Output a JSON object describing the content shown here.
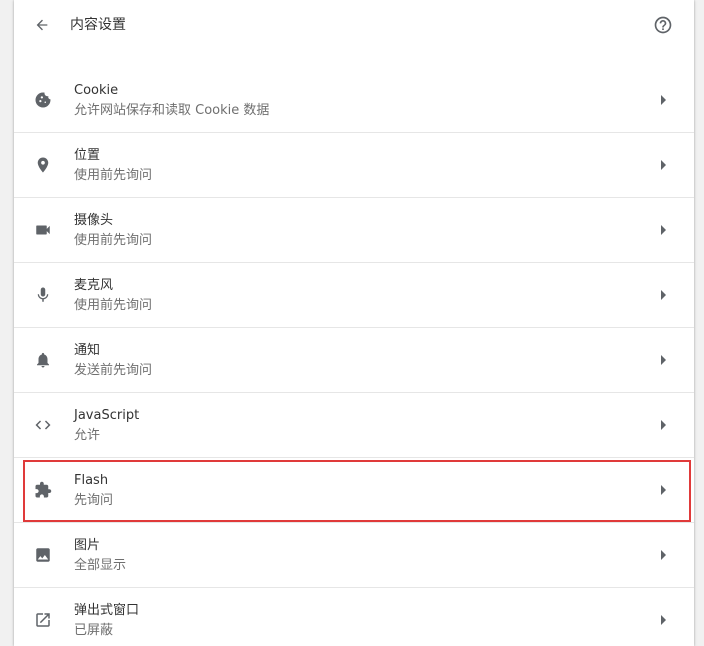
{
  "header": {
    "title": "内容设置",
    "back_icon": "arrow-back-icon",
    "help_icon": "help-icon"
  },
  "settings": [
    {
      "name": "cookie",
      "icon": "cookie-icon",
      "title": "Cookie",
      "subtitle": "允许网站保存和读取 Cookie 数据"
    },
    {
      "name": "location",
      "icon": "location-pin-icon",
      "title": "位置",
      "subtitle": "使用前先询问"
    },
    {
      "name": "camera",
      "icon": "videocam-icon",
      "title": "摄像头",
      "subtitle": "使用前先询问"
    },
    {
      "name": "microphone",
      "icon": "mic-icon",
      "title": "麦克风",
      "subtitle": "使用前先询问"
    },
    {
      "name": "notifications",
      "icon": "bell-icon",
      "title": "通知",
      "subtitle": "发送前先询问"
    },
    {
      "name": "javascript",
      "icon": "code-icon",
      "title": "JavaScript",
      "subtitle": "允许"
    },
    {
      "name": "flash",
      "icon": "puzzle-icon",
      "title": "Flash",
      "subtitle": "先询问"
    },
    {
      "name": "images",
      "icon": "image-icon",
      "title": "图片",
      "subtitle": "全部显示"
    },
    {
      "name": "popups",
      "icon": "open-in-new-icon",
      "title": "弹出式窗口",
      "subtitle": "已屏蔽"
    }
  ],
  "colors": {
    "highlight": "#e03a3a",
    "icon": "#5f6368"
  }
}
